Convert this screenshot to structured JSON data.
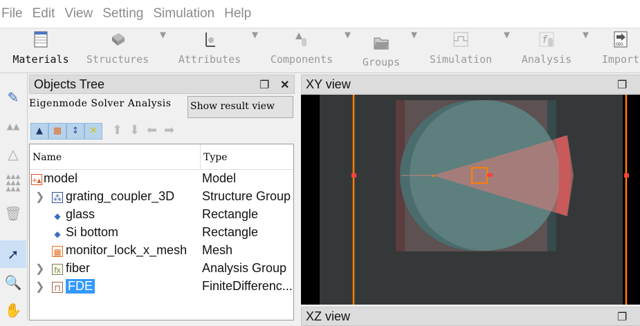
{
  "menu": [
    "File",
    "Edit",
    "View",
    "Setting",
    "Simulation",
    "Help"
  ],
  "toolbar": [
    {
      "label": "Materials",
      "icon": "materials-icon",
      "dropdown": false,
      "active": true
    },
    {
      "label": "Structures",
      "icon": "structures-icon",
      "dropdown": true
    },
    {
      "label": "Attributes",
      "icon": "attributes-icon",
      "dropdown": true
    },
    {
      "label": "Components",
      "icon": "components-icon",
      "dropdown": true
    },
    {
      "label": "Groups",
      "icon": "groups-icon",
      "dropdown": true
    },
    {
      "label": "Simulation",
      "icon": "simulation-icon",
      "dropdown": true
    },
    {
      "label": "Analysis",
      "icon": "analysis-icon",
      "dropdown": true
    },
    {
      "label": "Import",
      "icon": "import-gds-icon",
      "dropdown": false,
      "icon_text": "GDS"
    }
  ],
  "tree": {
    "title": "Objects Tree",
    "analysis_label": "Eigenmode Solver Analysis",
    "show_result": "Show result view",
    "columns": [
      "Name",
      "Type"
    ],
    "rows": [
      {
        "name": "model",
        "type": "Model",
        "icon": "model-icon",
        "expand": false,
        "indent": 0
      },
      {
        "name": "grating_coupler_3D",
        "type": "Structure Group",
        "icon": "structure-group-icon",
        "expand": true,
        "indent": 1
      },
      {
        "name": "glass",
        "type": "Rectangle",
        "icon": "rectangle-icon",
        "expand": false,
        "indent": 1
      },
      {
        "name": "Si bottom",
        "type": "Rectangle",
        "icon": "rectangle-icon",
        "expand": false,
        "indent": 1
      },
      {
        "name": "monitor_lock_x_mesh",
        "type": "Mesh",
        "icon": "mesh-icon",
        "expand": false,
        "indent": 1
      },
      {
        "name": "fiber",
        "type": "Analysis Group",
        "icon": "analysis-group-icon",
        "expand": true,
        "indent": 1
      },
      {
        "name": "FDE",
        "type": "FiniteDifferenc...",
        "icon": "fde-icon",
        "expand": true,
        "indent": 1,
        "selected": true
      }
    ]
  },
  "xy_view": {
    "title": "XY view"
  },
  "xz_view": {
    "title": "XZ view"
  },
  "colors": {
    "accent": "#ff8000",
    "selection": "#3399ff",
    "viewport": "#353839"
  }
}
